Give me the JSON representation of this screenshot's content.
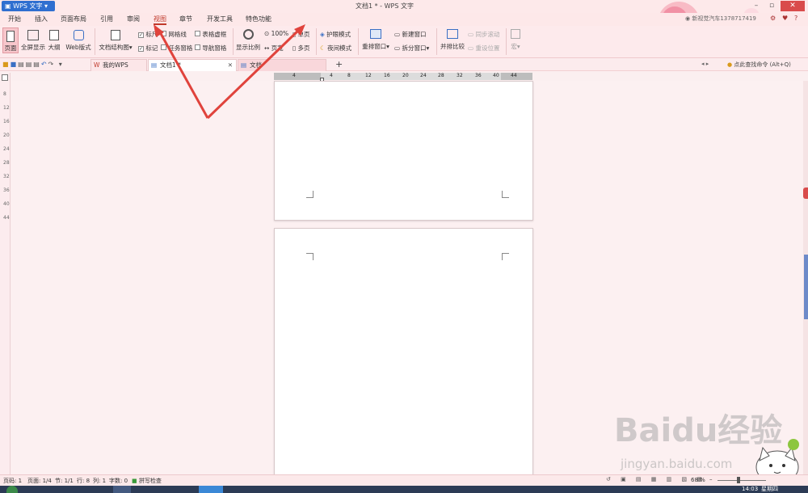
{
  "app": {
    "button_label": "WPS 文字",
    "title": "文档1 * - WPS 文字"
  },
  "menu": [
    "开始",
    "插入",
    "页面布局",
    "引用",
    "审阅",
    "视图",
    "章节",
    "开发工具",
    "特色功能"
  ],
  "active_menu": "视图",
  "account": {
    "user": "新视觉汽车1378717419"
  },
  "ribbon": {
    "page_view": "页面",
    "fullscreen": "全屏显示",
    "outline": "大纲",
    "web": "Web版式",
    "doc_map": "文档结构图",
    "ruler": "标尺",
    "gridlines": "网格线",
    "table_lines": "表格虚框",
    "marks": "标记",
    "task_pane": "任务窗格",
    "nav_pane": "导航窗格",
    "zoom_ratio": "显示比例",
    "zoom_100": "100%",
    "page_width": "页宽",
    "single_page": "单页",
    "multi_page": "多页",
    "eye_mode": "护眼模式",
    "night_mode": "夜间模式",
    "rearrange": "重排窗口",
    "new_window": "新建窗口",
    "split_window": "拆分窗口",
    "compare": "并排比较",
    "sync_scroll": "同步滚动",
    "reset_pos": "重设位置",
    "macro": "宏"
  },
  "tabs": [
    {
      "label": "我的WPS"
    },
    {
      "label": "文档1 *"
    },
    {
      "label": "文档"
    }
  ],
  "command_search": "点此查找命令 (Alt+Q)",
  "ruler_ticks": [
    "4",
    "4",
    "8",
    "12",
    "16",
    "20",
    "24",
    "28",
    "32",
    "36",
    "40",
    "44"
  ],
  "status": {
    "page": "页码: 1",
    "pages": "页面: 1/4",
    "section": "节: 1/1",
    "line": "行: 8",
    "col": "列: 1",
    "words": "字数: 0",
    "spell": "拼写检查",
    "zoom": "68 %"
  },
  "taskbar": {
    "time": "14:03",
    "day": "星期四"
  },
  "watermark": {
    "brand": "Baidu经验",
    "url": "jingyan.baidu.com"
  }
}
